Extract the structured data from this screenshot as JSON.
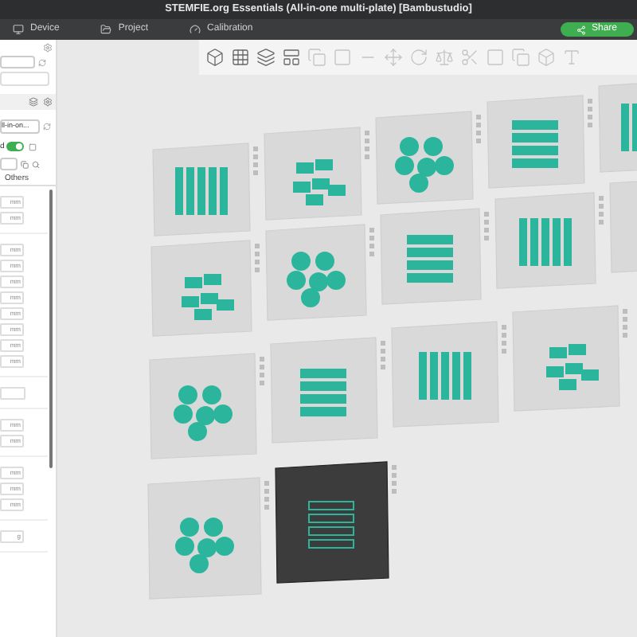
{
  "window": {
    "title": "STEMFIE.org Essentials (All-in-one multi-plate) [Bambustudio]"
  },
  "tabs": [
    {
      "label": "Device",
      "kind": "device"
    },
    {
      "label": "Project",
      "kind": "project"
    },
    {
      "label": "Calibration",
      "kind": "calibration"
    }
  ],
  "share_button": "Share",
  "sidebar": {
    "preset_field": "ll-in-on...",
    "toggle_label": "d",
    "toggle_on": true,
    "settings_tab": "Others",
    "groups": [
      {
        "fields": [
          {
            "unit": "mm"
          },
          {
            "unit": "mm"
          }
        ]
      },
      {
        "fields": [
          {
            "unit": "mm"
          },
          {
            "unit": "mm"
          },
          {
            "unit": "mm"
          },
          {
            "unit": "mm"
          },
          {
            "unit": "mm"
          },
          {
            "unit": "mm"
          },
          {
            "unit": "mm"
          },
          {
            "unit": "mm"
          }
        ]
      },
      {
        "fields": [
          {
            "kind": "blank"
          }
        ]
      },
      {
        "fields": [
          {
            "unit": "mm"
          },
          {
            "unit": "mm"
          }
        ]
      },
      {
        "fields": [
          {
            "unit": "mm"
          },
          {
            "unit": "mm"
          },
          {
            "unit": "mm"
          }
        ]
      },
      {
        "fields": [
          {
            "unit": "g"
          }
        ]
      }
    ]
  },
  "plates": [
    {
      "selected": false
    },
    {
      "selected": false
    },
    {
      "selected": false
    },
    {
      "selected": false
    },
    {
      "selected": false
    },
    {
      "selected": false
    },
    {
      "selected": false
    },
    {
      "selected": false
    },
    {
      "selected": false
    },
    {
      "selected": false
    },
    {
      "selected": false
    },
    {
      "selected": false
    },
    {
      "selected": false
    },
    {
      "selected": false
    },
    {
      "selected": false
    },
    {
      "selected": true
    }
  ]
}
